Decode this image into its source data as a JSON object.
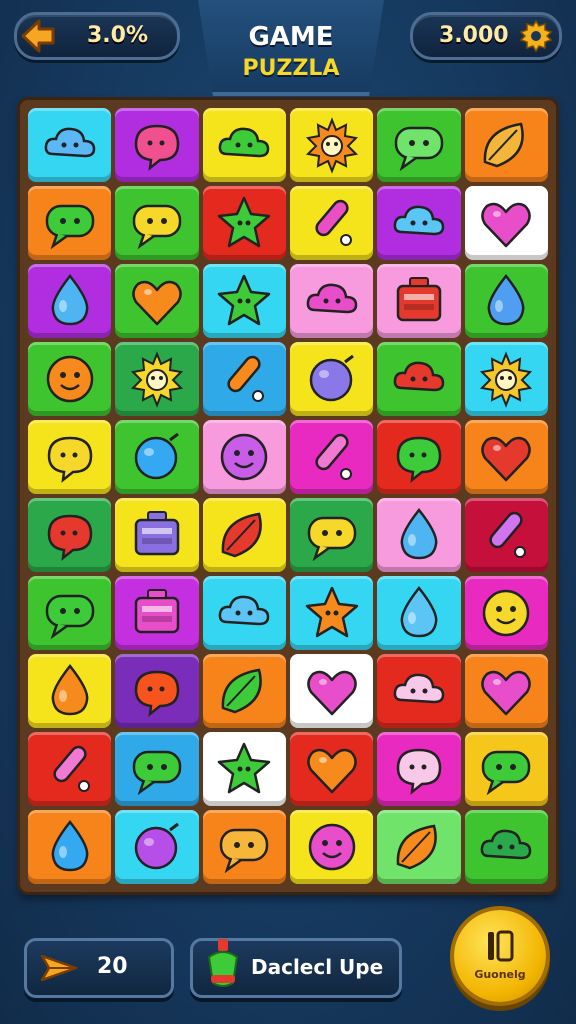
{
  "header": {
    "title_line1": "GAME",
    "title_line2": "PUZZLA",
    "left_value": "3.0%",
    "right_value": "3.000",
    "back_icon": "back-arrow-icon",
    "settings_icon": "gear-icon"
  },
  "board": {
    "tiles": [
      {
        "bg": "#35d6f2",
        "icon": "cloud",
        "c": "#5bb8f5"
      },
      {
        "bg": "#b12de0",
        "icon": "bubble",
        "c": "#f0508f"
      },
      {
        "bg": "#f5e31b",
        "icon": "cloud",
        "c": "#3ecb3a"
      },
      {
        "bg": "#f5e31b",
        "icon": "sun",
        "c": "#f78a1d"
      },
      {
        "bg": "#3ec42f",
        "icon": "chat",
        "c": "#6fe36a"
      },
      {
        "bg": "#f7831b",
        "icon": "leaf",
        "c": "#f4b63a"
      },
      {
        "bg": "#f7831b",
        "icon": "chat",
        "c": "#3ecb3a"
      },
      {
        "bg": "#3ec42f",
        "icon": "chat",
        "c": "#f5d82a"
      },
      {
        "bg": "#e42a1f",
        "icon": "star",
        "c": "#3ecb3a"
      },
      {
        "bg": "#f5e31b",
        "icon": "stick",
        "c": "#e94ec2"
      },
      {
        "bg": "#b12de0",
        "icon": "cloud",
        "c": "#5bc5f5"
      },
      {
        "bg": "#ffffff",
        "icon": "heart",
        "c": "#e84ec9"
      },
      {
        "bg": "#b12de0",
        "icon": "drop",
        "c": "#4fb5f2"
      },
      {
        "bg": "#3ec42f",
        "icon": "heart",
        "c": "#f78a1d"
      },
      {
        "bg": "#35d6f2",
        "icon": "star",
        "c": "#3ecb3a"
      },
      {
        "bg": "#f79bde",
        "icon": "cloud",
        "c": "#e84ec9"
      },
      {
        "bg": "#f79bde",
        "icon": "box",
        "c": "#e4392c"
      },
      {
        "bg": "#3ec42f",
        "icon": "drop",
        "c": "#4f9ef2"
      },
      {
        "bg": "#3ec42f",
        "icon": "face",
        "c": "#f78a1d"
      },
      {
        "bg": "#2aa84a",
        "icon": "sun",
        "c": "#f5d82a"
      },
      {
        "bg": "#2fa9e8",
        "icon": "stick",
        "c": "#f78a1d"
      },
      {
        "bg": "#f5e31b",
        "icon": "ball",
        "c": "#8a78e8"
      },
      {
        "bg": "#3ec42f",
        "icon": "cloud",
        "c": "#e4392c"
      },
      {
        "bg": "#35d6f2",
        "icon": "sun",
        "c": "#f5c72a"
      },
      {
        "bg": "#f5e31b",
        "icon": "bubble",
        "c": "#f5d82a"
      },
      {
        "bg": "#3ec42f",
        "icon": "ball",
        "c": "#35a8f2"
      },
      {
        "bg": "#f79bde",
        "icon": "face",
        "c": "#c85ee8"
      },
      {
        "bg": "#e82ac0",
        "icon": "stick",
        "c": "#f07ad2"
      },
      {
        "bg": "#e42a1f",
        "icon": "bubble",
        "c": "#3ecb3a"
      },
      {
        "bg": "#f7831b",
        "icon": "heart",
        "c": "#e4392c"
      },
      {
        "bg": "#2aa84a",
        "icon": "bubble",
        "c": "#e4392c"
      },
      {
        "bg": "#f5e31b",
        "icon": "box",
        "c": "#8a6fe0"
      },
      {
        "bg": "#f5e31b",
        "icon": "leaf",
        "c": "#e4392c"
      },
      {
        "bg": "#2aa84a",
        "icon": "chat",
        "c": "#f5d82a"
      },
      {
        "bg": "#f79bde",
        "icon": "drop",
        "c": "#4fb5f2"
      },
      {
        "bg": "#c4103a",
        "icon": "stick",
        "c": "#d074f0"
      },
      {
        "bg": "#3ec42f",
        "icon": "chat",
        "c": "#3ecb3a"
      },
      {
        "bg": "#c42fe0",
        "icon": "box",
        "c": "#e84ec9"
      },
      {
        "bg": "#35d6f2",
        "icon": "cloud",
        "c": "#5bc5f5"
      },
      {
        "bg": "#35d6f2",
        "icon": "star",
        "c": "#f78a1d"
      },
      {
        "bg": "#35d6f2",
        "icon": "drop",
        "c": "#5bc5f5"
      },
      {
        "bg": "#e82ac0",
        "icon": "face",
        "c": "#f5d82a"
      },
      {
        "bg": "#f5e31b",
        "icon": "drop",
        "c": "#f78a1d"
      },
      {
        "bg": "#7a2db8",
        "icon": "bubble",
        "c": "#f7541d"
      },
      {
        "bg": "#f7831b",
        "icon": "leaf",
        "c": "#3ecb3a"
      },
      {
        "bg": "#ffffff",
        "icon": "heart",
        "c": "#e84ec9"
      },
      {
        "bg": "#e42a1f",
        "icon": "cloud",
        "c": "#f7c8e8"
      },
      {
        "bg": "#f7831b",
        "icon": "heart",
        "c": "#e84ec9"
      },
      {
        "bg": "#e42a1f",
        "icon": "stick",
        "c": "#f07ad2"
      },
      {
        "bg": "#2fa9e8",
        "icon": "chat",
        "c": "#3ecb3a"
      },
      {
        "bg": "#ffffff",
        "icon": "star",
        "c": "#3ecb3a"
      },
      {
        "bg": "#e42a1f",
        "icon": "heart",
        "c": "#f78a1d"
      },
      {
        "bg": "#e82ac0",
        "icon": "bubble",
        "c": "#f7c8e8"
      },
      {
        "bg": "#f5c71b",
        "icon": "chat",
        "c": "#3ecb3a"
      },
      {
        "bg": "#f7831b",
        "icon": "drop",
        "c": "#35a8f2"
      },
      {
        "bg": "#35d6f2",
        "icon": "ball",
        "c": "#b64ee8"
      },
      {
        "bg": "#f7831b",
        "icon": "chat",
        "c": "#f5b63a"
      },
      {
        "bg": "#f5e31b",
        "icon": "face",
        "c": "#e84ec9"
      },
      {
        "bg": "#6fe36a",
        "icon": "leaf",
        "c": "#f78a1d"
      },
      {
        "bg": "#3ec42f",
        "icon": "cloud",
        "c": "#2aa84a"
      }
    ]
  },
  "footer": {
    "moves_count": "20",
    "powerup_label": "Daclecl Upe",
    "coin_label": "Guonelg",
    "moves_icon": "paper-plane-icon",
    "powerup_icon": "potion-icon"
  }
}
